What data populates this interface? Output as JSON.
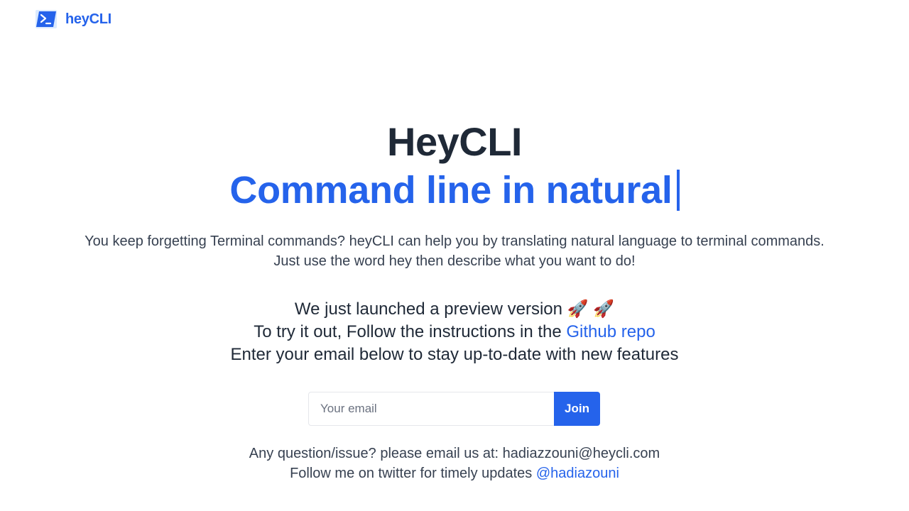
{
  "brand": {
    "name": "heyCLI",
    "icon": "terminal-prompt-icon",
    "color": "#2563eb"
  },
  "hero": {
    "title": "HeyCLI",
    "subtitle": "Command line in natural"
  },
  "description": {
    "line1": "You keep forgetting Terminal commands? heyCLI can help you by translating natural language to terminal commands.",
    "line2": "Just use the word hey then describe what you want to do!"
  },
  "info": {
    "line1": "We just launched a preview version 🚀 🚀",
    "line2_prefix": "To try it out, Follow the instructions in the ",
    "line2_link": "Github repo",
    "line3": "Enter your email below to stay up-to-date with new features"
  },
  "signup": {
    "placeholder": "Your email",
    "value": "",
    "button_label": "Join"
  },
  "footer": {
    "line1": "Any question/issue? please email us at: hadiazzouni@heycli.com",
    "line2_prefix": "Follow me on twitter for timely updates ",
    "twitter_handle": "@hadiazouni"
  },
  "colors": {
    "accent": "#2563eb",
    "text_dark": "#1f2937",
    "text_body": "#374151"
  }
}
